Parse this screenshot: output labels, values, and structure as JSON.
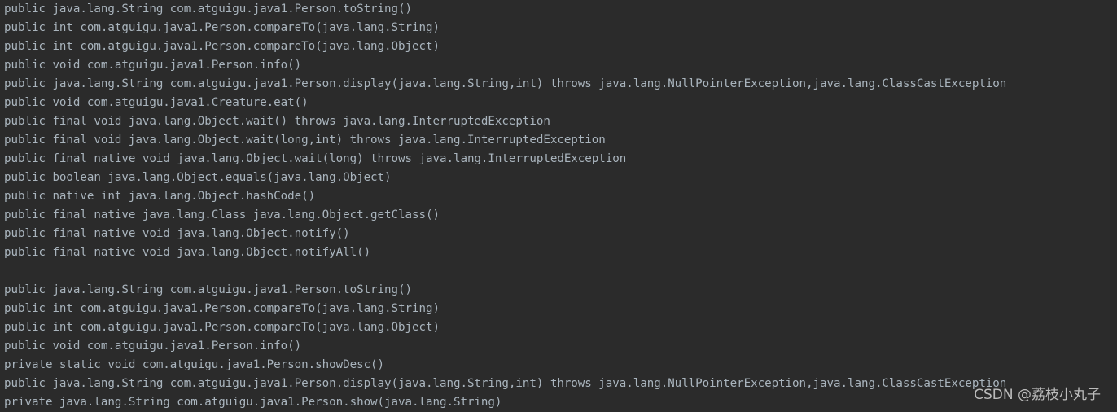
{
  "theme": {
    "background": "#2b2b2b",
    "text_color": "#a9b4bd",
    "watermark_color": "#c9c9c9"
  },
  "console": {
    "name": "java-reflection-console-output",
    "blocks": [
      {
        "id": "declared-and-inherited-public-methods",
        "lines": [
          "public java.lang.String com.atguigu.java1.Person.toString()",
          "public int com.atguigu.java1.Person.compareTo(java.lang.String)",
          "public int com.atguigu.java1.Person.compareTo(java.lang.Object)",
          "public void com.atguigu.java1.Person.info()",
          "public java.lang.String com.atguigu.java1.Person.display(java.lang.String,int) throws java.lang.NullPointerException,java.lang.ClassCastException",
          "public void com.atguigu.java1.Creature.eat()",
          "public final void java.lang.Object.wait() throws java.lang.InterruptedException",
          "public final void java.lang.Object.wait(long,int) throws java.lang.InterruptedException",
          "public final native void java.lang.Object.wait(long) throws java.lang.InterruptedException",
          "public boolean java.lang.Object.equals(java.lang.Object)",
          "public native int java.lang.Object.hashCode()",
          "public final native java.lang.Class java.lang.Object.getClass()",
          "public final native void java.lang.Object.notify()",
          "public final native void java.lang.Object.notifyAll()"
        ]
      },
      {
        "id": "declared-methods-only",
        "lines": [
          "public java.lang.String com.atguigu.java1.Person.toString()",
          "public int com.atguigu.java1.Person.compareTo(java.lang.String)",
          "public int com.atguigu.java1.Person.compareTo(java.lang.Object)",
          "public void com.atguigu.java1.Person.info()",
          "private static void com.atguigu.java1.Person.showDesc()",
          "public java.lang.String com.atguigu.java1.Person.display(java.lang.String,int) throws java.lang.NullPointerException,java.lang.ClassCastException",
          "private java.lang.String com.atguigu.java1.Person.show(java.lang.String)"
        ]
      }
    ],
    "separator": ""
  },
  "watermark": {
    "text": "CSDN @荔枝小丸子"
  }
}
